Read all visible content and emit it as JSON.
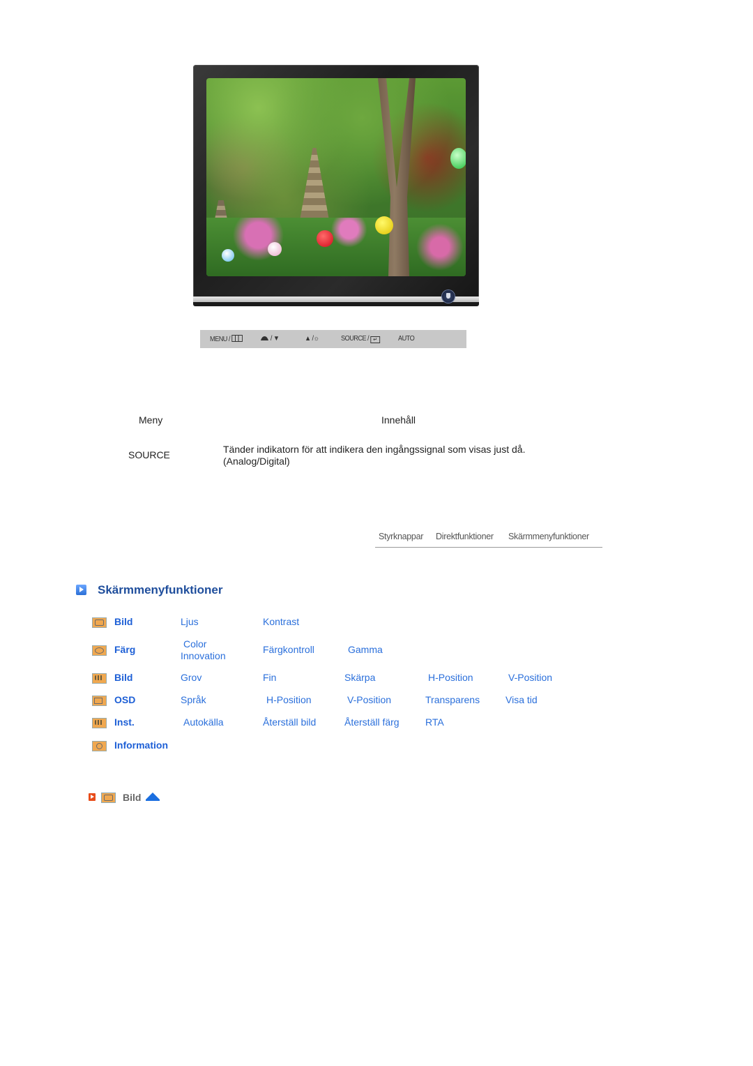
{
  "monitor": {
    "image_alt": "Garden with stone pagodas and colorful lanterns",
    "power_icon": "power-icon"
  },
  "control_strip": {
    "buttons": [
      {
        "label": "MENU /",
        "icon": "menu-grid-icon"
      },
      {
        "label": "/ ▼",
        "icon": "brightness-down-icon"
      },
      {
        "label": "▲ /☼",
        "icon": "brightness-up-icon"
      },
      {
        "label": "SOURCE /",
        "icon": "enter-icon"
      },
      {
        "label": "AUTO",
        "icon": ""
      }
    ]
  },
  "table": {
    "header_menu": "Meny",
    "header_content": "Innehåll",
    "rows": [
      {
        "menu": "SOURCE",
        "content_line1": "Tänder indikatorn för att indikera den ingångssignal som visas just då.",
        "content_line2": "(Analog/Digital)"
      }
    ]
  },
  "nav_tabs": [
    "Styrknappar",
    "Direktfunktioner",
    "Skärmmenyfunktioner"
  ],
  "section": {
    "title": "Skärmmenyfunktioner",
    "icon": "play-arrow-icon"
  },
  "menu_grid": [
    {
      "label": "Bild",
      "icon": "picture-icon",
      "items": [
        "Ljus",
        "Kontrast"
      ]
    },
    {
      "label": "Färg",
      "icon": "color-icon",
      "items": [
        "Color Innovation",
        "Färgkontroll",
        "Gamma"
      ],
      "items_split": [
        "Color",
        "Innovation"
      ]
    },
    {
      "label": "Bild",
      "icon": "image-adjust-icon",
      "items": [
        "Grov",
        "Fin",
        "Skärpa",
        "H-Position",
        "V-Position"
      ]
    },
    {
      "label": "OSD",
      "icon": "osd-icon",
      "items": [
        "Språk",
        "H-Position",
        "V-Position",
        "Transparens",
        "Visa tid"
      ]
    },
    {
      "label": "Inst.",
      "icon": "setup-icon",
      "items": [
        "Autokälla",
        "Återställ bild",
        "Återställ färg",
        "RTA"
      ]
    },
    {
      "label": "Information",
      "icon": "information-icon",
      "items": []
    }
  ],
  "footer_nav": {
    "label": "Bild",
    "arrow_icon": "play-arrow-icon",
    "section_icon": "picture-icon",
    "up_icon": "up-arrow-icon"
  }
}
